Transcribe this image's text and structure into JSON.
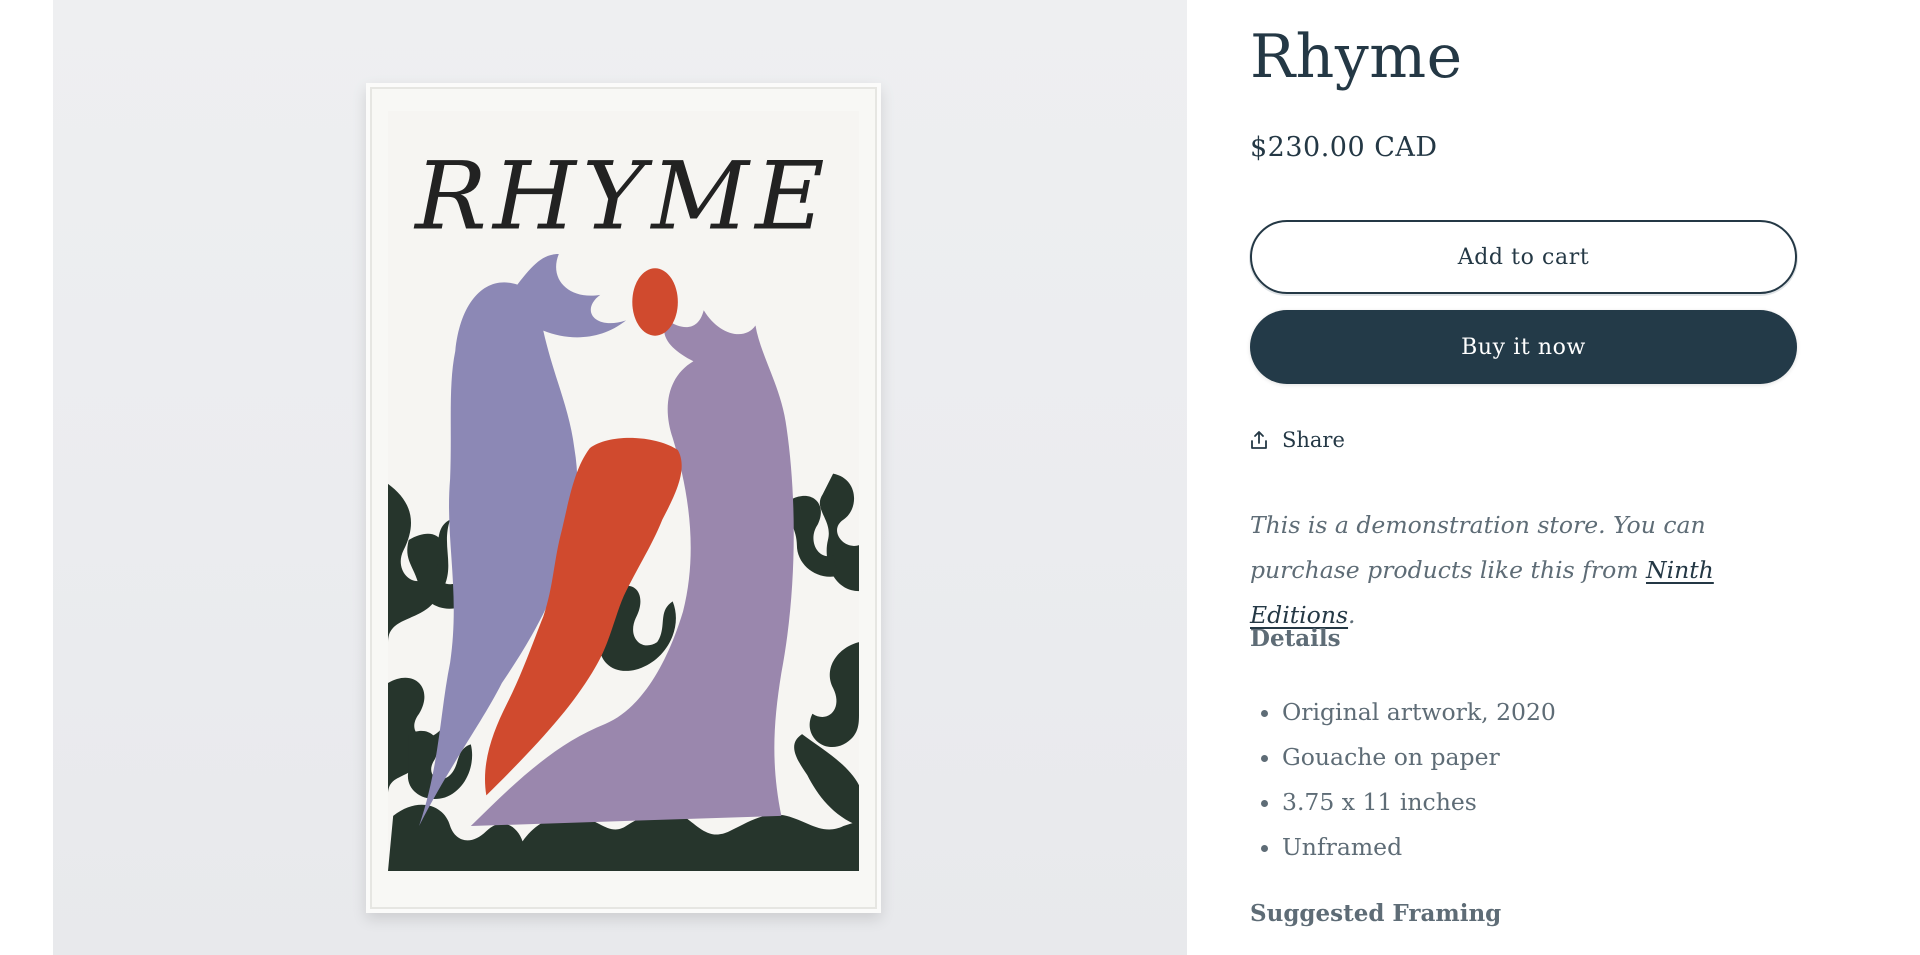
{
  "product": {
    "title": "Rhyme",
    "price": "$230.00 CAD",
    "image_text": "RHYME"
  },
  "actions": {
    "add_to_cart": "Add to cart",
    "buy_now": "Buy it now",
    "share": "Share"
  },
  "description": {
    "text_before": "This is a demonstration store. You can purchase products like this from ",
    "link_text": "Ninth Editions",
    "text_after": "."
  },
  "details": {
    "heading": "Details",
    "items": [
      "Original artwork, 2020",
      "Gouache on paper",
      "3.75 x 11 inches",
      "Unframed"
    ]
  },
  "framing": {
    "heading": "Suggested Framing"
  },
  "colors": {
    "primary": "#233a48",
    "muted_text": "#5e6c76",
    "art_red": "#d04a2e",
    "art_purple": "#8f8ab6",
    "art_green": "#26352c"
  }
}
